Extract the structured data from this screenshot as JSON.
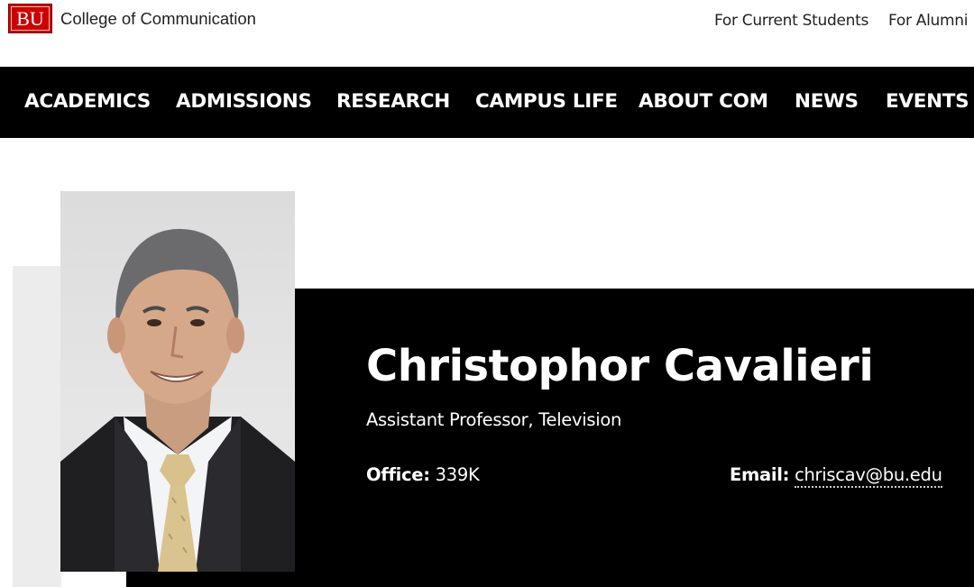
{
  "header": {
    "logo_text": "BU",
    "college_name": "College of Communication",
    "utility_links": [
      "For Current Students",
      "For Alumni"
    ]
  },
  "nav": {
    "items": [
      "ACADEMICS",
      "ADMISSIONS",
      "RESEARCH",
      "CAMPUS LIFE",
      "ABOUT COM",
      "NEWS",
      "EVENTS"
    ]
  },
  "profile": {
    "name": "Christophor Cavalieri",
    "title": "Assistant Professor, Television",
    "office_label": "Office:",
    "office_value": "339K",
    "email_label": "Email:",
    "email_value": "chriscav@bu.edu",
    "photo_icon": "faculty-portrait"
  },
  "colors": {
    "brand_red": "#cc0000",
    "nav_bg": "#000000",
    "panel_bg": "#000000",
    "accent_gray": "#ececec"
  }
}
